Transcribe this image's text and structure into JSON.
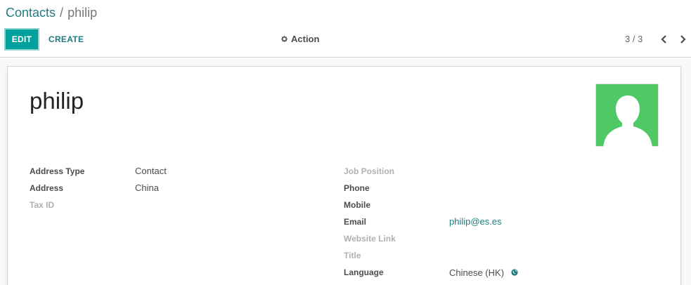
{
  "breadcrumb": {
    "parent": "Contacts",
    "separator": "/",
    "current": "philip"
  },
  "toolbar": {
    "edit_label": "EDIT",
    "create_label": "CREATE",
    "action_label": "Action"
  },
  "pager": {
    "value": "3 / 3"
  },
  "icons": {
    "action": "gear-icon",
    "prev": "chevron-left-icon",
    "next": "chevron-right-icon",
    "avatar": "user-silhouette-icon",
    "language": "globe-icon"
  },
  "colors": {
    "accent": "#00a09d",
    "link": "#1f7c80",
    "avatar_bg": "#4fc866"
  },
  "contact": {
    "name": "philip",
    "left": [
      {
        "label": "Address Type",
        "value": "Contact"
      },
      {
        "label": "Address",
        "value": "China"
      },
      {
        "label": "Tax ID",
        "value": ""
      }
    ],
    "right": [
      {
        "label": "Job Position",
        "value": ""
      },
      {
        "label": "Phone",
        "value": ""
      },
      {
        "label": "Mobile",
        "value": ""
      },
      {
        "label": "Email",
        "value": "philip@es.es"
      },
      {
        "label": "Website Link",
        "value": ""
      },
      {
        "label": "Title",
        "value": ""
      },
      {
        "label": "Language",
        "value": "Chinese (HK)"
      }
    ]
  }
}
